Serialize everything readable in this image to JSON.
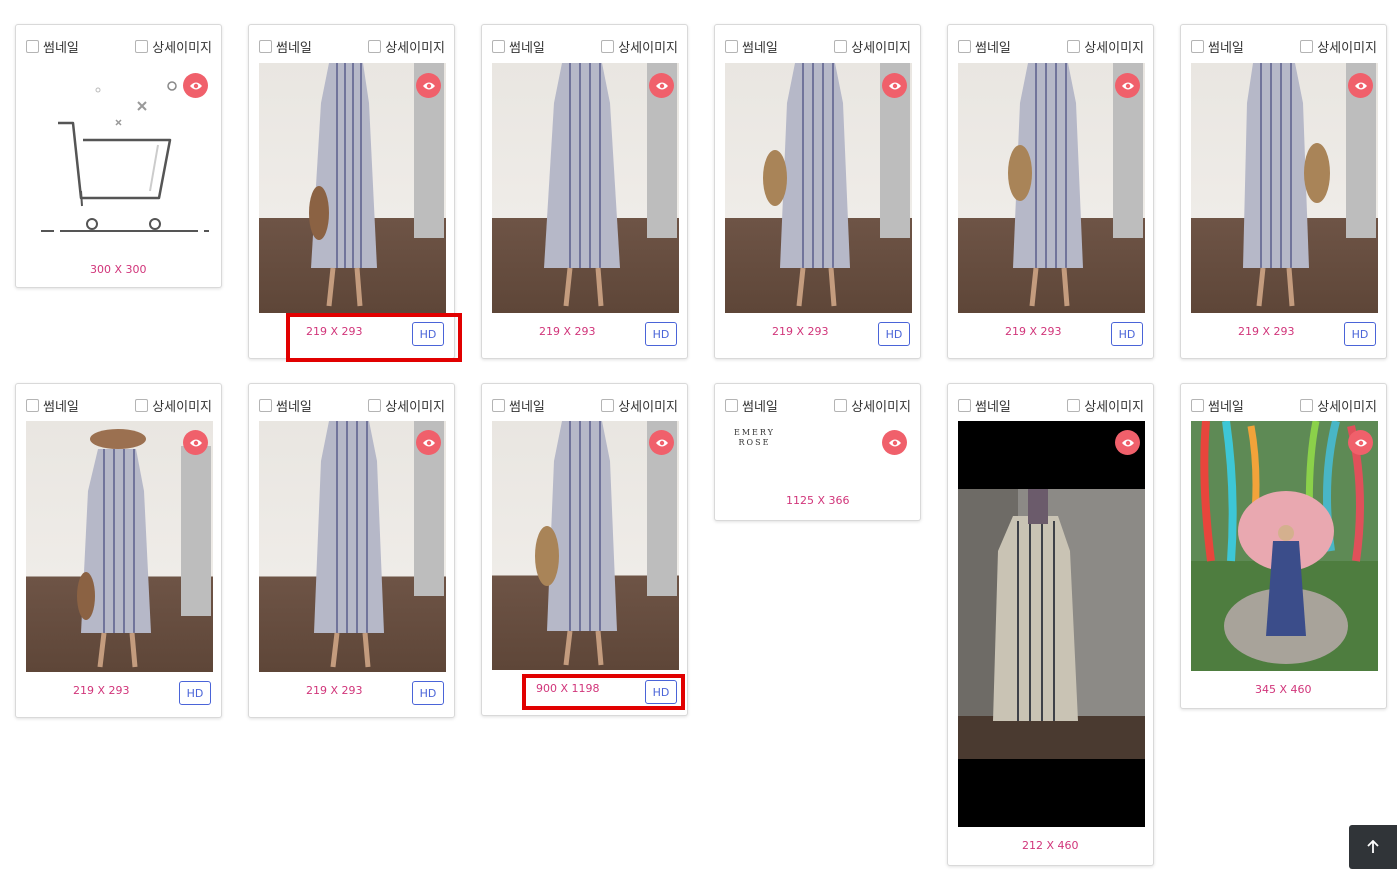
{
  "labels": {
    "thumbnail": "썸네일",
    "detail_image": "상세이미지",
    "hd": "HD"
  },
  "cards": [
    {
      "id": 1,
      "size": "300 X 300",
      "image": "cart-placeholder-icon"
    },
    {
      "id": 2,
      "size": "219 X 293",
      "image": "dress-photo",
      "hd": true,
      "highlight": true
    },
    {
      "id": 3,
      "size": "219 X 293",
      "image": "dress-photo-back",
      "hd": true
    },
    {
      "id": 4,
      "size": "219 X 293",
      "image": "dress-photo",
      "hd": true
    },
    {
      "id": 5,
      "size": "219 X 293",
      "image": "dress-photo",
      "hd": true
    },
    {
      "id": 6,
      "size": "219 X 293",
      "image": "dress-photo",
      "hd": true
    },
    {
      "id": 7,
      "size": "219 X 293",
      "image": "dress-photo-hat",
      "hd": true
    },
    {
      "id": 8,
      "size": "219 X 293",
      "image": "dress-photo",
      "hd": true
    },
    {
      "id": 9,
      "size": "900 X 1198",
      "image": "dress-photo",
      "hd": true,
      "highlight": true
    },
    {
      "id": 10,
      "size": "1125 X 366",
      "image": "brand-logo",
      "logo_text": [
        "EMERY",
        "ROSE"
      ]
    },
    {
      "id": 11,
      "size": "212 X 460",
      "image": "mirror-selfie-photo"
    },
    {
      "id": 12,
      "size": "345 X 460",
      "image": "garden-sculpture-photo"
    }
  ],
  "colors": {
    "eye": "#f0606b",
    "dims": "#d1357a",
    "hd": "#4a64d8",
    "highlight": "#e10000",
    "scroll_top": "#303438"
  },
  "icons": {
    "eye": "eye-icon",
    "scroll_top": "arrow-up-icon"
  }
}
